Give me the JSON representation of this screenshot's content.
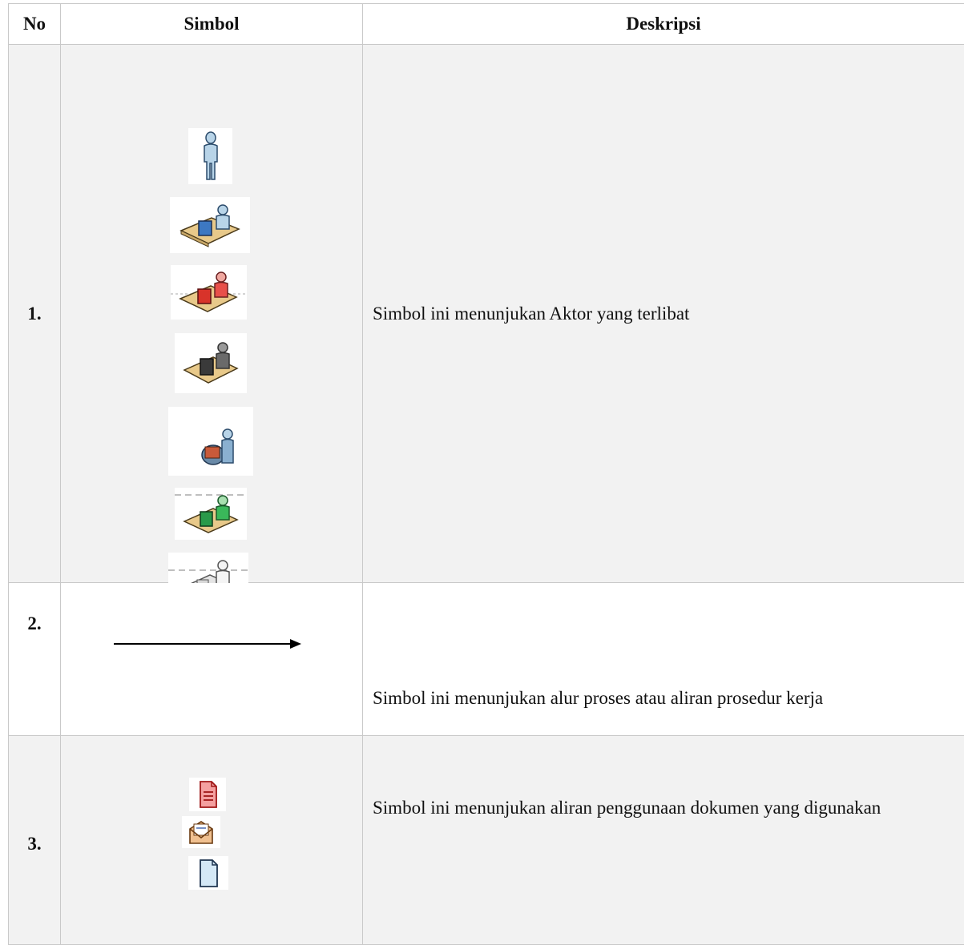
{
  "table": {
    "headers": {
      "no": "No",
      "symbol": "Simbol",
      "description": "Deskripsi"
    },
    "rows": [
      {
        "no": "1.",
        "description": "Simbol ini menunjukan Aktor yang terlibat",
        "icons": [
          "standing-person-icon",
          "person-at-blue-desk-icon",
          "person-at-red-desk-icon",
          "person-at-dark-desk-icon",
          "person-with-machine-icon",
          "person-at-green-desk-icon",
          "person-at-gray-desk-icon"
        ]
      },
      {
        "no": "2.",
        "description": "Simbol ini menunjukan alur proses atau aliran prosedur kerja",
        "icons": [
          "flow-arrow-icon"
        ]
      },
      {
        "no": "3.",
        "description": "Simbol ini menunjukan aliran penggunaan dokumen yang digunakan",
        "icons": [
          "red-document-icon",
          "envelope-icon",
          "blank-document-icon"
        ]
      }
    ]
  },
  "colors": {
    "header_bg": "#ffffff",
    "shaded_row_bg": "#f2f2f2",
    "border": "#c9c9c9",
    "text": "#111111"
  }
}
